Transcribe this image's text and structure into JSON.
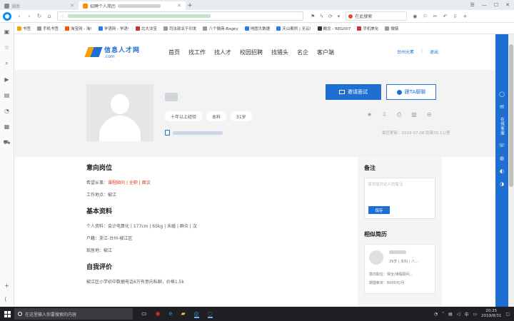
{
  "browser": {
    "tab1_title": "湖南",
    "tab2_title": "招聘个人简历",
    "win_buttons": [
      "☰",
      "—",
      "☐",
      "✕"
    ],
    "search_text": "在此搜索",
    "bookmarks": [
      "书签",
      "手机书签",
      "淘宝网 - 淘!",
      "学语网 - 学语!",
      "北大法宝",
      "司法部关于印发",
      "八个微商-Bagey",
      "地图大数据",
      "天山案例 | 无讼!",
      "概念 - REG007",
      "手机美化",
      "微链"
    ]
  },
  "site": {
    "brand_title": "信息人才网",
    "brand_sub": ".com",
    "nav": [
      "首页",
      "找工作",
      "找人才",
      "校园招聘",
      "找猎头",
      "名企",
      "客户端"
    ],
    "user_city": "台州元素",
    "logout": "退出"
  },
  "profile": {
    "tags": [
      "十年以上经验",
      "本科",
      "31岁"
    ],
    "invite_button": "邀请面试",
    "chat_button": "跟TA聊聊",
    "update_line": "最近更新：2019-07-08  距离39.1公里"
  },
  "content": {
    "intent_title": "意向岗位",
    "intent_label": "希望从事：",
    "intent_values": [
      "课程顾问",
      "全职",
      "面议"
    ],
    "workplace_label": "工作地点：",
    "workplace_value": "椒江",
    "basic_title": "基本资料",
    "basic_label": "个人资料：",
    "basic_value": "会计电算化 | 177cm | 65kg | 未婚 | 群众 | 汉",
    "hukou_label": "户籍：",
    "hukou_value": "浙江-台州-椒江区",
    "residence_label": "现居地：",
    "residence_value": "椒江",
    "self_title": "自我评价",
    "self_text": "椒江区小学初中数据电话6万有意向私聊，价格1.5k"
  },
  "side": {
    "note_title": "备注",
    "note_placeholder": "请添加对此人的备注",
    "save_button": "保存",
    "similar_title": "相似简历",
    "similar_meta": "29岁 | 本科 | 八...",
    "similar_intent": "意向职位：",
    "similar_intent_value": "保全/课程顾问...",
    "similar_salary": "期望薪资：",
    "similar_salary_value": "6000元/月"
  },
  "rightbar_text": "在线客服",
  "taskbar": {
    "search_placeholder": "在这里输入你要搜索的内容",
    "ime": "中",
    "time": "20:25",
    "date": "2019/8/31"
  }
}
